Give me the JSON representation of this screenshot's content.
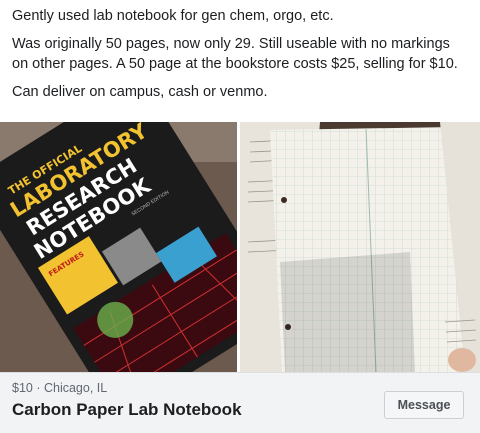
{
  "post": {
    "paragraphs": [
      "Gently used lab notebook for gen chem, orgo, etc.",
      "Was originally 50 pages, now only 29. Still useable with no markings on other pages. A 50 page at the bookstore costs $25, selling for $10.",
      "Can deliver on campus, cash or venmo."
    ]
  },
  "photos": {
    "left": {
      "cover_line1": "THE OFFICIAL",
      "cover_line2": "LABORATORY",
      "cover_line3": "RESEARCH",
      "cover_line4": "NOTEBOOK",
      "edition": "SECOND EDITION",
      "badge": "FEATURES"
    }
  },
  "listing": {
    "price": "$10",
    "separator": " · ",
    "location": "Chicago, IL",
    "title": "Carbon Paper Lab Notebook",
    "message_button": "Message"
  },
  "colors": {
    "accent": "#606770",
    "book_cover": "#1b1b1b",
    "title_text": "#f2c230"
  }
}
